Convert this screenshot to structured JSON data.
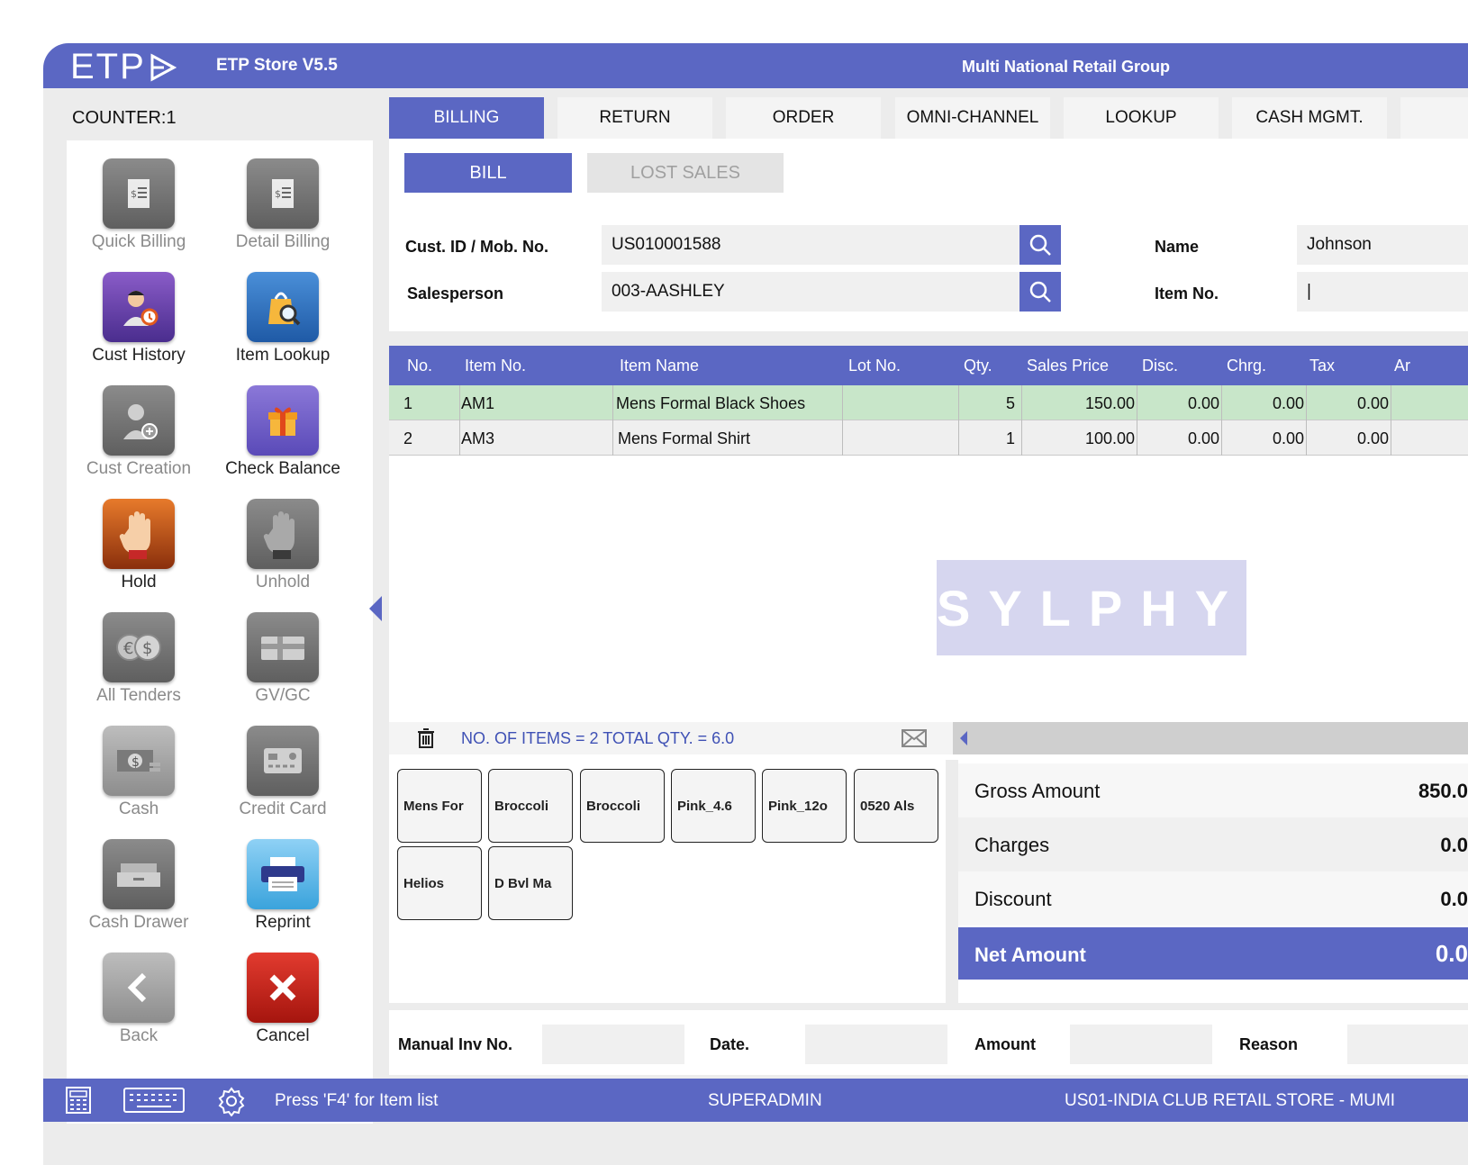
{
  "header": {
    "logo": "ETP",
    "app_version": "ETP Store V5.5",
    "org_name": "Multi National Retail Group"
  },
  "counter": "COUNTER:1",
  "sidebar": {
    "items": [
      {
        "label": "Quick Billing",
        "icon": "receipt-icon",
        "enabled": false
      },
      {
        "label": "Detail Billing",
        "icon": "receipt-list-icon",
        "enabled": false
      },
      {
        "label": "Cust History",
        "icon": "customer-history-icon",
        "enabled": true
      },
      {
        "label": "Item Lookup",
        "icon": "bag-search-icon",
        "enabled": true
      },
      {
        "label": "Cust Creation",
        "icon": "add-customer-icon",
        "enabled": false
      },
      {
        "label": "Check Balance",
        "icon": "gift-icon",
        "enabled": true
      },
      {
        "label": "Hold",
        "icon": "hand-icon",
        "enabled": true
      },
      {
        "label": "Unhold",
        "icon": "hand-gray-icon",
        "enabled": false
      },
      {
        "label": "All Tenders",
        "icon": "currency-icon",
        "enabled": false
      },
      {
        "label": "GV/GC",
        "icon": "gift-card-icon",
        "enabled": false
      },
      {
        "label": "Cash",
        "icon": "cash-icon",
        "enabled": false
      },
      {
        "label": "Credit Card",
        "icon": "credit-card-icon",
        "enabled": false
      },
      {
        "label": "Cash Drawer",
        "icon": "cash-drawer-icon",
        "enabled": false
      },
      {
        "label": "Reprint",
        "icon": "printer-icon",
        "enabled": true
      },
      {
        "label": "Back",
        "icon": "chevron-left-icon",
        "enabled": false
      },
      {
        "label": "Cancel",
        "icon": "close-icon",
        "enabled": true
      }
    ]
  },
  "tabs": [
    "BILLING",
    "RETURN",
    "ORDER",
    "OMNI-CHANNEL",
    "LOOKUP",
    "CASH MGMT."
  ],
  "sub_tabs": {
    "bill": "BILL",
    "lost_sales": "LOST SALES"
  },
  "form": {
    "cust_label": "Cust. ID / Mob. No.",
    "cust_value": "US010001588",
    "salesperson_label": "Salesperson",
    "salesperson_value": "003-AASHLEY",
    "name_label": "Name",
    "name_value": "Johnson",
    "item_no_label": "Item No.",
    "item_no_value": "|"
  },
  "grid": {
    "headers": [
      "No.",
      "Item No.",
      "Item Name",
      "Lot No.",
      "Qty.",
      "Sales Price",
      "Disc.",
      "Chrg.",
      "Tax",
      "Ar"
    ],
    "rows": [
      {
        "no": "1",
        "item_no": "AM1",
        "item_name": "Mens Formal Black Shoes",
        "lot": "",
        "qty": "5",
        "price": "150.00",
        "disc": "0.00",
        "chrg": "0.00",
        "tax": "0.00"
      },
      {
        "no": "2",
        "item_no": "AM3",
        "item_name": "Mens Formal Shirt",
        "lot": "",
        "qty": "1",
        "price": "100.00",
        "disc": "0.00",
        "chrg": "0.00",
        "tax": "0.00"
      }
    ]
  },
  "watermark": "SYLPHY",
  "summary": "NO. OF ITEMS = 2   TOTAL QTY. = 6.0",
  "quick_items": [
    "Mens For",
    "Broccoli",
    "Broccoli",
    "Pink_4.6",
    "Pink_12o",
    "0520 Als",
    "Helios",
    "D Bvl Ma"
  ],
  "totals": {
    "gross_label": "Gross Amount",
    "gross_value": "850.0",
    "charges_label": "Charges",
    "charges_value": "0.0",
    "discount_label": "Discount",
    "discount_value": "0.0",
    "net_label": "Net Amount",
    "net_value": "0.0"
  },
  "manual": {
    "inv_label": "Manual Inv No.",
    "date_label": "Date.",
    "amount_label": "Amount",
    "reason_label": "Reason"
  },
  "footer": {
    "hint": "Press 'F4' for Item list",
    "user": "SUPERADMIN",
    "store": "US01-INDIA CLUB RETAIL STORE - MUMI"
  },
  "colors": {
    "accent": "#5b67c3",
    "selected_row": "#c8e6c9",
    "cancel": "#d32f2f"
  }
}
